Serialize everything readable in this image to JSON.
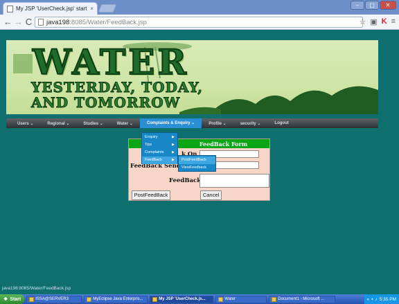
{
  "browser": {
    "tab_title": "My JSP 'UserCheck.jsp' startin",
    "tab_close": "×",
    "url_host": "java198",
    "url_port": ":8085",
    "url_path": "/Water/FeedBack.jsp",
    "window_buttons": [
      "–",
      "▢",
      "✕"
    ]
  },
  "banner": {
    "headline": "WATER",
    "tagline_1": "YESTERDAY, TODAY,",
    "tagline_2": "AND TOMORROW"
  },
  "menu": {
    "items": [
      "Users ⌄",
      "Regional ⌄",
      "Studies ⌄",
      "Water ⌄",
      "Complaints & Enquiry ⌄",
      "Profile ⌄",
      "security ⌄",
      "Logout"
    ],
    "active_index": 4
  },
  "dropdown": {
    "items": [
      "Enquiry",
      "Tips",
      "Complaints",
      "FeedBack"
    ],
    "highlighted": "FeedBack",
    "submenu": [
      "PostFeedBack",
      "ViewFeedback"
    ],
    "submenu_highlighted": "PostFeedBack"
  },
  "form": {
    "header": "FeedBack Form",
    "label_row1_partial": "k On :",
    "label_sender": "FeedBack Sender :",
    "label_feedback": "FeedBack :",
    "submit_label": "PostFeedBack",
    "cancel_label": "Cancel"
  },
  "status_bar": "java198:8085/Water/FeedBack.jsp",
  "taskbar": {
    "start_label": "Start",
    "items": [
      {
        "label": "ISSA@SERVER3",
        "active": false
      },
      {
        "label": "MyEclipse Java Enterpris...",
        "active": false
      },
      {
        "label": "My JSP 'UserCheck.js...",
        "active": true
      },
      {
        "label": "Water",
        "active": false
      },
      {
        "label": "Document1 - Microsoft ...",
        "active": false
      }
    ],
    "clock": "5:35 PM"
  }
}
